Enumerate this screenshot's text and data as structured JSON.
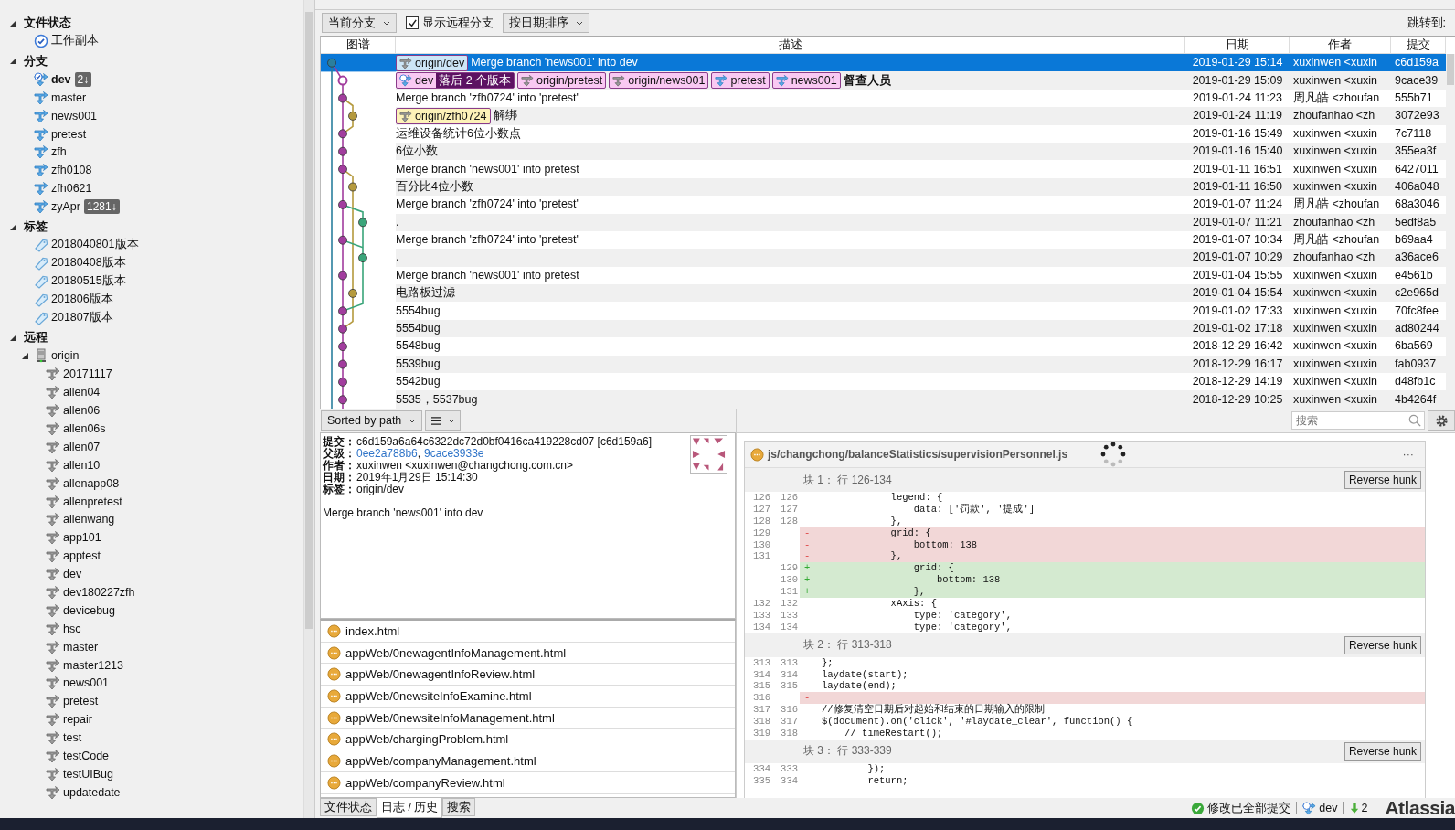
{
  "toolbar": {
    "branch_filter": "当前分支",
    "show_remote": {
      "label": "显示远程分支",
      "checked": true
    },
    "sort": "按日期排序",
    "jump_label": "跳转到:"
  },
  "sidebar": {
    "sections": [
      {
        "title": "文件状态",
        "expanded": true,
        "items": [
          {
            "label": "工作副本",
            "kind": "workcopy"
          }
        ]
      },
      {
        "title": "分支",
        "expanded": true,
        "items": [
          {
            "label": "dev",
            "kind": "current-branch",
            "badge": "2↓"
          },
          {
            "label": "master",
            "kind": "branch"
          },
          {
            "label": "news001",
            "kind": "branch"
          },
          {
            "label": "pretest",
            "kind": "branch"
          },
          {
            "label": "zfh",
            "kind": "branch"
          },
          {
            "label": "zfh0108",
            "kind": "branch"
          },
          {
            "label": "zfh0621",
            "kind": "branch"
          },
          {
            "label": "zyApr",
            "kind": "branch",
            "badge": "1281↓"
          }
        ]
      },
      {
        "title": "标签",
        "expanded": true,
        "items": [
          {
            "label": "2018040801版本",
            "kind": "tag"
          },
          {
            "label": "20180408版本",
            "kind": "tag"
          },
          {
            "label": "20180515版本",
            "kind": "tag"
          },
          {
            "label": "201806版本",
            "kind": "tag"
          },
          {
            "label": "201807版本",
            "kind": "tag"
          }
        ]
      },
      {
        "title": "远程",
        "expanded": true,
        "items": [
          {
            "label": "origin",
            "kind": "remote",
            "expanded": true,
            "children": [
              {
                "label": "20171117",
                "kind": "remote-branch"
              },
              {
                "label": "allen04",
                "kind": "remote-branch"
              },
              {
                "label": "allen06",
                "kind": "remote-branch"
              },
              {
                "label": "allen06s",
                "kind": "remote-branch"
              },
              {
                "label": "allen07",
                "kind": "remote-branch"
              },
              {
                "label": "allen10",
                "kind": "remote-branch"
              },
              {
                "label": "allenapp08",
                "kind": "remote-branch"
              },
              {
                "label": "allenpretest",
                "kind": "remote-branch"
              },
              {
                "label": "allenwang",
                "kind": "remote-branch"
              },
              {
                "label": "app101",
                "kind": "remote-branch"
              },
              {
                "label": "apptest",
                "kind": "remote-branch"
              },
              {
                "label": "dev",
                "kind": "remote-branch"
              },
              {
                "label": "dev180227zfh",
                "kind": "remote-branch"
              },
              {
                "label": "devicebug",
                "kind": "remote-branch"
              },
              {
                "label": "hsc",
                "kind": "remote-branch"
              },
              {
                "label": "master",
                "kind": "remote-branch"
              },
              {
                "label": "master1213",
                "kind": "remote-branch"
              },
              {
                "label": "news001",
                "kind": "remote-branch"
              },
              {
                "label": "pretest",
                "kind": "remote-branch"
              },
              {
                "label": "repair",
                "kind": "remote-branch"
              },
              {
                "label": "test",
                "kind": "remote-branch"
              },
              {
                "label": "testCode",
                "kind": "remote-branch"
              },
              {
                "label": "testUIBug",
                "kind": "remote-branch"
              },
              {
                "label": "updatedate",
                "kind": "remote-branch"
              }
            ]
          }
        ]
      }
    ]
  },
  "commits": {
    "columns": [
      "图谱",
      "描述",
      "日期",
      "作者",
      "提交"
    ],
    "rows": [
      {
        "selected": true,
        "refs": [
          {
            "label": "origin/dev",
            "kind": "remote",
            "color": "#cde6f7"
          }
        ],
        "message": "Merge branch 'news001' into dev",
        "date": "2019-01-29 15:14",
        "author": "xuxinwen <xuxin",
        "commit": "c6d159a"
      },
      {
        "selected": false,
        "refs": [
          {
            "label": "dev",
            "kind": "current",
            "behind": "落后 2 个版本",
            "color": "#f9c9f2"
          },
          {
            "label": "origin/pretest",
            "kind": "remote",
            "color": "#f9c9f2"
          },
          {
            "label": "origin/news001",
            "kind": "remote",
            "color": "#f9c9f2"
          },
          {
            "label": "pretest",
            "kind": "local",
            "color": "#f9c9f2"
          },
          {
            "label": "news001",
            "kind": "local",
            "color": "#f9c9f2"
          }
        ],
        "message": "督查人员",
        "bold": true,
        "date": "2019-01-29 15:09",
        "author": "xuxinwen <xuxin",
        "commit": "9cace39"
      },
      {
        "selected": false,
        "message": "Merge branch 'zfh0724' into 'pretest'",
        "date": "2019-01-24 11:23",
        "author": "周凡皓 <zhoufan",
        "commit": "555b71"
      },
      {
        "selected": false,
        "refs": [
          {
            "label": "origin/zfh0724",
            "kind": "remote",
            "color": "#fdf2b8"
          }
        ],
        "message": "解绑",
        "date": "2019-01-24 11:19",
        "author": "zhoufanhao <zh",
        "commit": "3072e93"
      },
      {
        "selected": false,
        "message": "运维设备统计6位小数点",
        "date": "2019-01-16 15:49",
        "author": "xuxinwen <xuxin",
        "commit": "7c7118"
      },
      {
        "selected": false,
        "message": "6位小数",
        "date": "2019-01-16 15:40",
        "author": "xuxinwen <xuxin",
        "commit": "355ea3f"
      },
      {
        "selected": false,
        "message": "Merge branch 'news001' into pretest",
        "date": "2019-01-11 16:51",
        "author": "xuxinwen <xuxin",
        "commit": "6427011"
      },
      {
        "selected": false,
        "message": "百分比4位小数",
        "date": "2019-01-11 16:50",
        "author": "xuxinwen <xuxin",
        "commit": "406a048"
      },
      {
        "selected": false,
        "message": "Merge branch 'zfh0724' into 'pretest'",
        "date": "2019-01-07 11:24",
        "author": "周凡皓 <zhoufan",
        "commit": "68a3046"
      },
      {
        "selected": false,
        "message": ".",
        "date": "2019-01-07 11:21",
        "author": "zhoufanhao <zh",
        "commit": "5edf8a5"
      },
      {
        "selected": false,
        "message": "Merge branch 'zfh0724' into 'pretest'",
        "date": "2019-01-07 10:34",
        "author": "周凡皓 <zhoufan",
        "commit": "b69aa4"
      },
      {
        "selected": false,
        "message": ".",
        "date": "2019-01-07 10:29",
        "author": "zhoufanhao <zh",
        "commit": "a36ace6"
      },
      {
        "selected": false,
        "message": "Merge branch 'news001' into pretest",
        "date": "2019-01-04 15:55",
        "author": "xuxinwen <xuxin",
        "commit": "e4561b"
      },
      {
        "selected": false,
        "message": "电路板过滤",
        "date": "2019-01-04 15:54",
        "author": "xuxinwen <xuxin",
        "commit": "c2e965d"
      },
      {
        "selected": false,
        "message": "5554bug",
        "date": "2019-01-02 17:33",
        "author": "xuxinwen <xuxin",
        "commit": "70fc8fee"
      },
      {
        "selected": false,
        "message": "5554bug",
        "date": "2019-01-02 17:18",
        "author": "xuxinwen <xuxin",
        "commit": "ad80244"
      },
      {
        "selected": false,
        "message": "5548bug",
        "date": "2018-12-29 16:42",
        "author": "xuxinwen <xuxin",
        "commit": "6ba569"
      },
      {
        "selected": false,
        "message": "5539bug",
        "date": "2018-12-29 16:17",
        "author": "xuxinwen <xuxin",
        "commit": "fab0937"
      },
      {
        "selected": false,
        "message": "5542bug",
        "date": "2018-12-29 14:19",
        "author": "xuxinwen <xuxin",
        "commit": "d48fb1c"
      },
      {
        "selected": false,
        "message": "5535，5537bug",
        "date": "2018-12-29 10:25",
        "author": "xuxinwen <xuxin",
        "commit": "4b4264f"
      }
    ]
  },
  "details": {
    "sort": "Sorted by path",
    "fields": [
      {
        "label": "提交：",
        "value": "c6d159a6a64c6322dc72d0bf0416ca419228cd07 [c6d159a6]"
      },
      {
        "label": "父级：",
        "links": [
          "0ee2a788b6",
          "9cace3933e"
        ],
        "separator": ","
      },
      {
        "label": "作者：",
        "value": "xuxinwen <xuxinwen@changchong.com.cn>"
      },
      {
        "label": "日期：",
        "value": "2019年1月29日 15:14:30"
      },
      {
        "label": "标签：",
        "value": "origin/dev"
      }
    ],
    "message": "Merge branch 'news001' into dev",
    "files": [
      "index.html",
      "appWeb/0newagentInfoManagement.html",
      "appWeb/0newagentInfoReview.html",
      "appWeb/0newsiteInfoExamine.html",
      "appWeb/0newsiteInfoManagement.html",
      "appWeb/chargingProblem.html",
      "appWeb/companyManagement.html",
      "appWeb/companyReview.html"
    ]
  },
  "diff": {
    "search_placeholder": "搜索",
    "file": "js/changchong/balanceStatistics/supervisionPersonnel.js",
    "more": "···",
    "hunks": [
      {
        "title": "块 1： 行 126-134",
        "button": "Reverse hunk",
        "lines": [
          {
            "old": "126",
            "new": "126",
            "kind": "context",
            "text": "            legend: {"
          },
          {
            "old": "127",
            "new": "127",
            "kind": "context",
            "text": "                data: ['罚款', '提成']"
          },
          {
            "old": "128",
            "new": "128",
            "kind": "context",
            "text": "            },"
          },
          {
            "old": "129",
            "kind": "del",
            "marker": "-",
            "text": "            grid: {"
          },
          {
            "old": "130",
            "kind": "del",
            "marker": "-",
            "text": "                bottom: 138"
          },
          {
            "old": "131",
            "kind": "del",
            "marker": "-",
            "text": "            },"
          },
          {
            "new": "129",
            "kind": "add",
            "marker": "+",
            "text": "                grid: {"
          },
          {
            "new": "130",
            "kind": "add",
            "marker": "+",
            "text": "                    bottom: 138"
          },
          {
            "new": "131",
            "kind": "add",
            "marker": "+",
            "text": "                },"
          },
          {
            "old": "132",
            "new": "132",
            "kind": "context",
            "text": "            xAxis: {"
          },
          {
            "old": "133",
            "new": "133",
            "kind": "context",
            "text": "                type: 'category',"
          },
          {
            "old": "134",
            "new": "134",
            "kind": "context",
            "text": "                type: 'category',"
          }
        ]
      },
      {
        "title": "块 2： 行 313-318",
        "button": "Reverse hunk",
        "lines": [
          {
            "old": "313",
            "new": "313",
            "kind": "context",
            "text": "};"
          },
          {
            "old": "314",
            "new": "314",
            "kind": "context",
            "text": "laydate(start);"
          },
          {
            "old": "315",
            "new": "315",
            "kind": "context",
            "text": "laydate(end);"
          },
          {
            "old": "316",
            "kind": "del",
            "marker": "-"
          },
          {
            "old": "317",
            "new": "316",
            "kind": "context",
            "text": "//修复清空日期后对起始和结束的日期输入的限制"
          },
          {
            "old": "318",
            "new": "317",
            "kind": "context",
            "text": "$(document).on('click', '#laydate_clear', function() {"
          },
          {
            "old": "319",
            "new": "318",
            "kind": "context",
            "text": "    // timeRestart();"
          }
        ]
      },
      {
        "title": "块 3： 行 333-339",
        "button": "Reverse hunk",
        "lines": [
          {
            "old": "334",
            "new": "333",
            "kind": "context",
            "text": "        });"
          },
          {
            "old": "335",
            "new": "334",
            "kind": "context",
            "text": "        return;"
          }
        ]
      }
    ]
  },
  "bottom_tabs": [
    {
      "label": "文件状态",
      "selected": false
    },
    {
      "label": "日志 / 历史",
      "selected": true
    },
    {
      "label": "搜索",
      "selected": false
    }
  ],
  "status_bar": {
    "status": "修改已全部提交",
    "branch": "dev",
    "pull_count": "2",
    "brand": "Atlassia"
  }
}
